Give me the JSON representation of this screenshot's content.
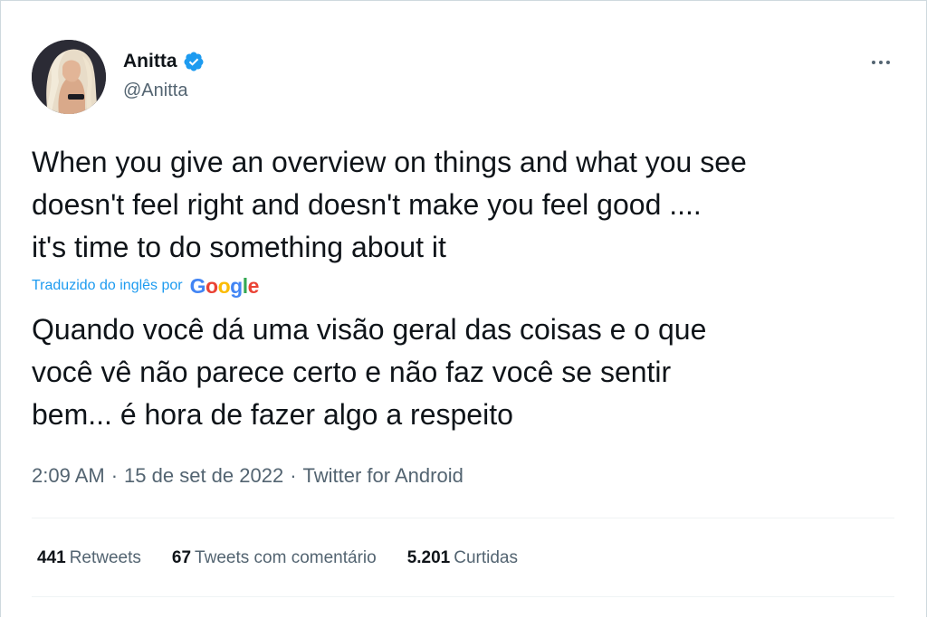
{
  "author": {
    "display_name": "Anitta",
    "handle": "@Anitta",
    "verified": true
  },
  "tweet": {
    "text": "When you give an overview on things and what you see\ndoesn't feel right and doesn't make you feel good ....\nit's time to do something about it",
    "translation_label": "Traduzido do inglês por",
    "translation_provider": "Google",
    "translated_text": "Quando você dá uma visão geral das coisas e o que\nvocê vê não parece certo e não faz você se sentir\nbem... é hora de fazer algo a respeito",
    "time": "2:09 AM",
    "date": "15 de set de 2022",
    "source": "Twitter for Android",
    "separator": "·"
  },
  "stats": {
    "retweets": {
      "count": "441",
      "label": "Retweets"
    },
    "quotes": {
      "count": "67",
      "label": "Tweets com comentário"
    },
    "likes": {
      "count": "5.201",
      "label": "Curtidas"
    }
  },
  "icons": {
    "verified": "verified-badge-icon",
    "more": "more-options-icon"
  },
  "colors": {
    "accent": "#1d9bf0",
    "text_primary": "#0f1419",
    "text_secondary": "#536471",
    "divider": "#eff3f4"
  }
}
